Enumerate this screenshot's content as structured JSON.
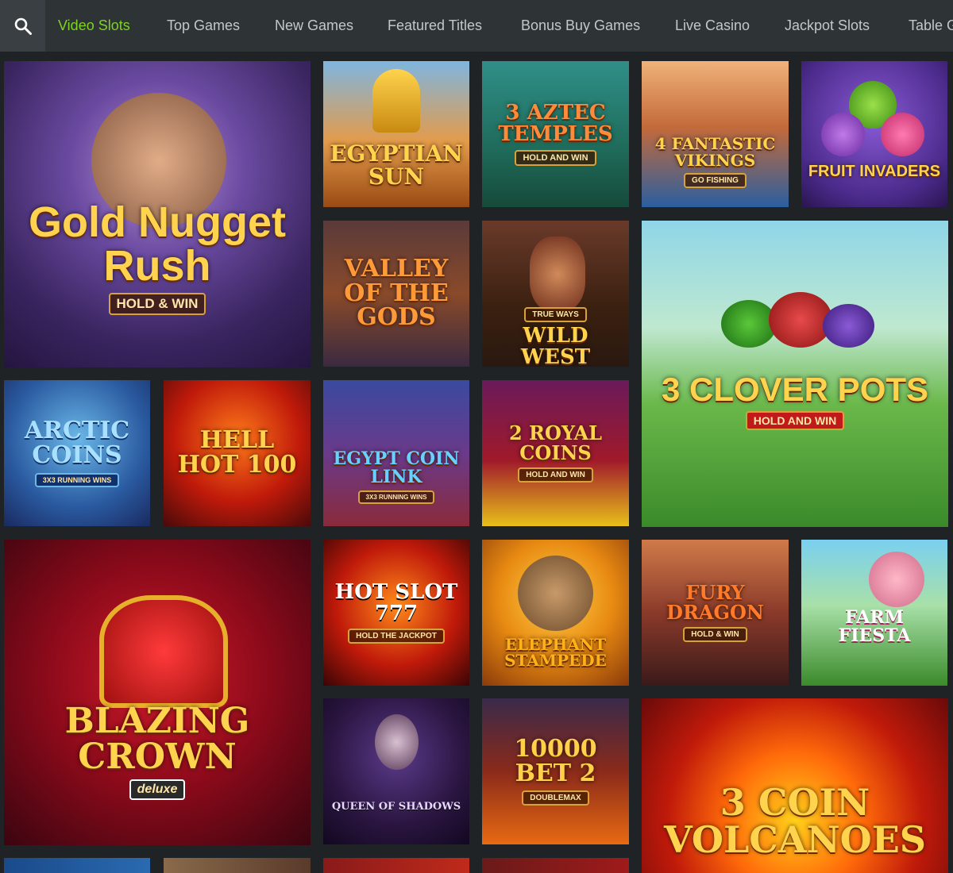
{
  "nav": {
    "search_icon": "search-icon",
    "tabs": [
      {
        "label": "Video Slots",
        "active": true
      },
      {
        "label": "Top Games"
      },
      {
        "label": "New Games"
      },
      {
        "label": "Featured Titles"
      },
      {
        "label": "Bonus Buy Games"
      },
      {
        "label": "Live Casino"
      },
      {
        "label": "Jackpot Slots"
      },
      {
        "label": "Table G"
      }
    ]
  },
  "colors": {
    "accent": "#7dd321",
    "page_bg": "#1f2326",
    "nav_bg": "#2e3336"
  },
  "games": [
    {
      "title": "Gold Nugget Rush",
      "subtitle": "HOLD & WIN"
    },
    {
      "title": "EGYPTIAN SUN",
      "subtitle": ""
    },
    {
      "title": "3 AZTEC TEMPLES",
      "subtitle": "HOLD AND WIN"
    },
    {
      "title": "4 FANTASTIC VIKINGS",
      "subtitle": "GO FISHING"
    },
    {
      "title": "FRUIT INVADERS",
      "subtitle": ""
    },
    {
      "title": "VALLEY OF THE GODS",
      "subtitle": ""
    },
    {
      "title": "WILD WEST",
      "subtitle": "TRUE WAYS"
    },
    {
      "title": "3 CLOVER POTS",
      "subtitle": "HOLD AND WIN"
    },
    {
      "title": "ARCTIC COINS",
      "subtitle": "3X3 RUNNING WINS"
    },
    {
      "title": "HELL HOT 100",
      "subtitle": ""
    },
    {
      "title": "EGYPT COIN LINK",
      "subtitle": "3X3 RUNNING WINS"
    },
    {
      "title": "2 ROYAL COINS",
      "subtitle": "HOLD AND WIN"
    },
    {
      "title": "BLAZING CROWN",
      "subtitle": "deluxe"
    },
    {
      "title": "HOT SLOT 777",
      "subtitle": "HOLD THE JACKPOT"
    },
    {
      "title": "ELEPHANT STAMPEDE",
      "subtitle": ""
    },
    {
      "title": "FURY DRAGON",
      "subtitle": "HOLD & WIN"
    },
    {
      "title": "FARM FIESTA",
      "subtitle": ""
    },
    {
      "title": "QUEEN OF SHADOWS",
      "subtitle": ""
    },
    {
      "title": "10000 BET 2",
      "subtitle": "DOUBLEMAX"
    },
    {
      "title": "3 COIN VOLCANOES",
      "subtitle": ""
    },
    {
      "title": "",
      "subtitle": ""
    },
    {
      "title": "",
      "subtitle": ""
    },
    {
      "title": "",
      "subtitle": ""
    },
    {
      "title": "",
      "subtitle": ""
    }
  ]
}
